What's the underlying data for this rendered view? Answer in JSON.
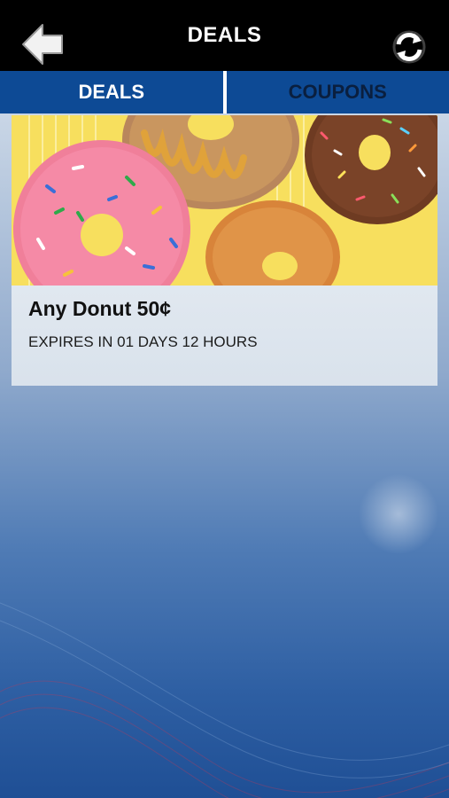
{
  "header": {
    "title": "DEALS",
    "back_icon": "back-arrow-icon",
    "refresh_icon": "refresh-icon"
  },
  "tabs": [
    {
      "label": "DEALS",
      "active": true
    },
    {
      "label": "COUPONS",
      "active": false
    }
  ],
  "deals": [
    {
      "title": "Any Donut 50¢",
      "expiry": "EXPIRES IN 01 DAYS 12 HOURS"
    }
  ],
  "colors": {
    "header_bg": "#000000",
    "tab_bar_bg": "#0d4a95",
    "promo_yellow": "#f7df5e"
  }
}
